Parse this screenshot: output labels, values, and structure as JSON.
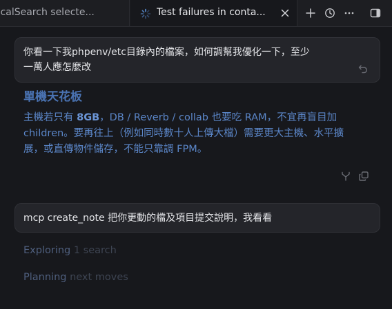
{
  "tabs": [
    {
      "label": "ocalSearch selecte..."
    },
    {
      "label": "Test failures in conta..."
    }
  ],
  "messages": {
    "user_1": {
      "line1": "你看一下我phpenv/etc目錄內的檔案，如何調幫我優化一下，至少",
      "line2": "一萬人應怎麼改"
    },
    "answer": {
      "heading": "單機天花板",
      "line1_pre": "主機若只有 ",
      "line1_bold": "8GB",
      "line1_post": "，DB / Reverb / collab 也要吃 RAM，不宜再盲目加",
      "line2": "children。要再往上（例如同時數十人上傳大檔）需要更大主機、水平擴",
      "line3": "展，或直傳物件儲存，不能只靠調 FPM。"
    },
    "user_2": {
      "text": "mcp create_note 把你更動的檔及項目提交說明，我看看"
    }
  },
  "status": {
    "exploring_label": "Exploring",
    "exploring_detail": "1 search",
    "planning_label": "Planning",
    "planning_detail": "next moves"
  },
  "icons": {
    "spinner": "spinner-icon",
    "close": "close-icon",
    "plus": "plus-icon",
    "history": "history-icon",
    "more": "more-icon",
    "panel": "panel-toggle-icon",
    "undo": "undo-icon",
    "fork": "fork-icon",
    "copy": "copy-icon"
  },
  "colors": {
    "background": "#17181c",
    "bubble": "#24252a",
    "answer_text": "#5b86c8",
    "status_text": "#4f5f7e"
  }
}
